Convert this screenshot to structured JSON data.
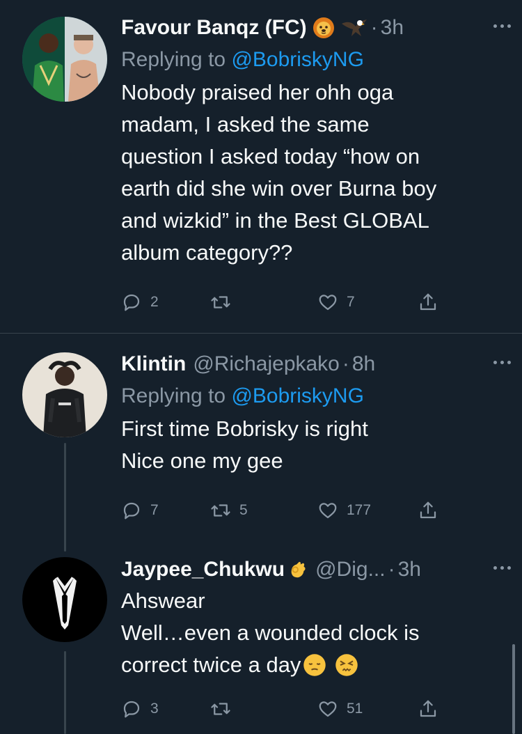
{
  "tweets": [
    {
      "name": "Favour Banqz (FC)",
      "handle": "",
      "time": "3h",
      "replying_prefix": "Replying to",
      "replying_to": "@BobriskyNG",
      "text": "Nobody praised her ohh oga madam, I asked the same question I asked today  “how on earth did she win over Burna boy and wizkid” in the Best GLOBAL album category??",
      "lines": [
        "Nobody praised her ohh oga",
        "madam, I asked the same",
        "question I asked today  “how on",
        "earth did she win over Burna boy",
        "and wizkid” in the Best GLOBAL",
        "album category??"
      ],
      "name_emojis": [
        "lion-face-emoji",
        "eagle-emoji"
      ],
      "replies": "2",
      "retweets": "",
      "likes": "7"
    },
    {
      "name": "Klintin",
      "handle": "@Richajepkako",
      "time": "8h",
      "replying_prefix": "Replying to",
      "replying_to": "@BobriskyNG",
      "lines": [
        "First time Bobrisky is right",
        "Nice one my gee"
      ],
      "replies": "7",
      "retweets": "5",
      "likes": "177"
    },
    {
      "name": "Jaypee_Chukwu",
      "handle": "@Dig...",
      "time": "3h",
      "lines": [
        "Ahswear",
        "Well…even a wounded clock is",
        "correct twice a day"
      ],
      "name_emojis": [
        "ok-hand-emoji"
      ],
      "text_emojis": [
        "pensive-face-emoji",
        "persevering-face-emoji"
      ],
      "replies": "3",
      "retweets": "",
      "likes": "51"
    }
  ],
  "separator": "·",
  "colors": {
    "background": "#15202b",
    "primary_text": "#f7f9f9",
    "secondary_text": "#8b98a5",
    "link": "#1d9bf0",
    "divider": "#38444d"
  }
}
